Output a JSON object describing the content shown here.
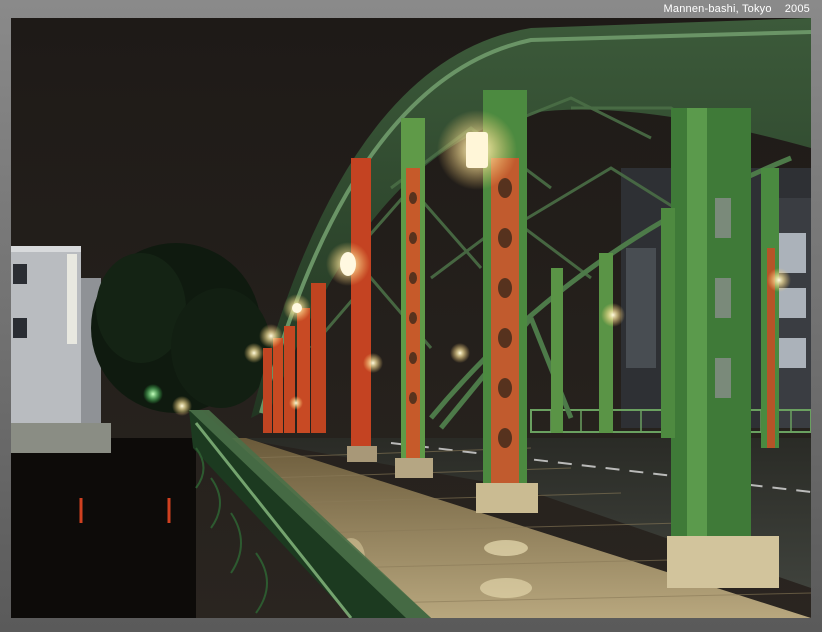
{
  "caption": {
    "title": "Mannen-bashi, Tokyo",
    "year": "2005"
  }
}
